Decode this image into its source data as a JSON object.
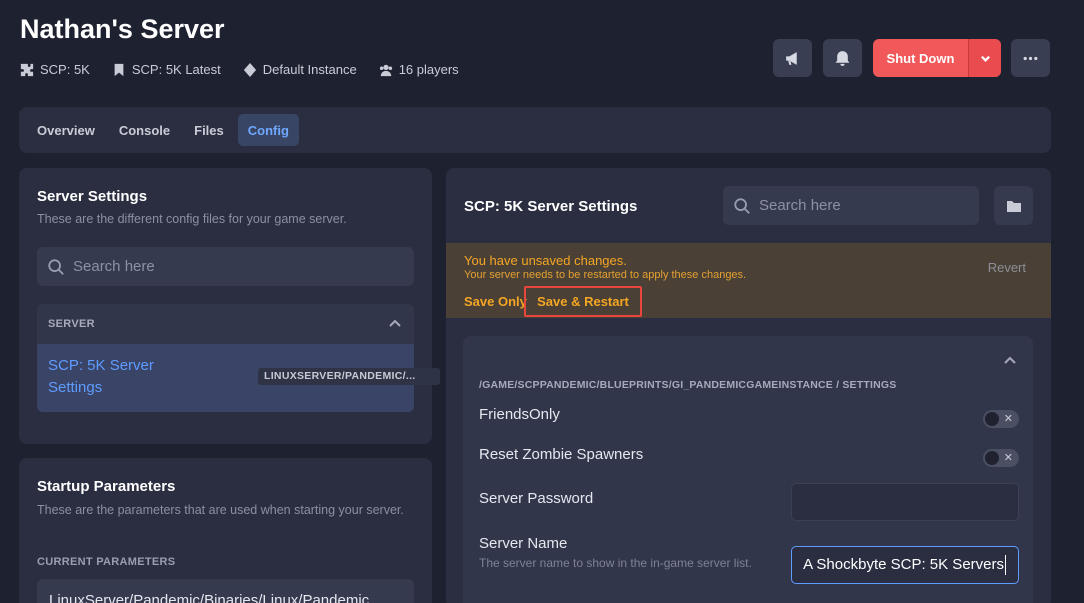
{
  "header": {
    "title": "Nathan's Server",
    "meta": {
      "game": "SCP: 5K",
      "version": "SCP: 5K Latest",
      "instance": "Default Instance",
      "players": "16 players"
    },
    "shutdown_label": "Shut Down"
  },
  "tabs": [
    "Overview",
    "Console",
    "Files",
    "Config"
  ],
  "active_tab": "Config",
  "server_settings": {
    "title": "Server Settings",
    "subtitle": "These are the different config files for your game server.",
    "search_placeholder": "Search here",
    "group_label": "SERVER",
    "item_name": "SCP: 5K Server Settings",
    "item_path": "LINUXSERVER/PANDEMIC/..."
  },
  "startup": {
    "title": "Startup Parameters",
    "subtitle": "These are the parameters that are used when starting your server.",
    "current_label": "CURRENT PARAMETERS",
    "current_value": "LinuxServer/Pandemic/Binaries/Linux/Pandemic"
  },
  "config_panel": {
    "title": "SCP: 5K Server Settings",
    "search_placeholder": "Search here",
    "unsaved_title": "You have unsaved changes.",
    "unsaved_sub": "Your server needs to be restarted to apply these changes.",
    "revert": "Revert",
    "save_only": "Save Only",
    "save_restart": "Save & Restart",
    "section_path": "/GAME/SCPPANDEMIC/BLUEPRINTS/GI_PANDEMICGAMEINSTANCE / SETTINGS",
    "settings": {
      "friends_only": {
        "label": "FriendsOnly",
        "enabled": false
      },
      "reset_zombie": {
        "label": "Reset Zombie Spawners",
        "enabled": false
      },
      "password": {
        "label": "Server Password",
        "value": ""
      },
      "server_name": {
        "label": "Server Name",
        "description": "The server name to show in the in-game server list.",
        "value": "A Shockbyte SCP: 5K Servers"
      }
    }
  },
  "colors": {
    "accent": "#5f9cff",
    "danger": "#f0585a",
    "warning": "#f5a623"
  }
}
